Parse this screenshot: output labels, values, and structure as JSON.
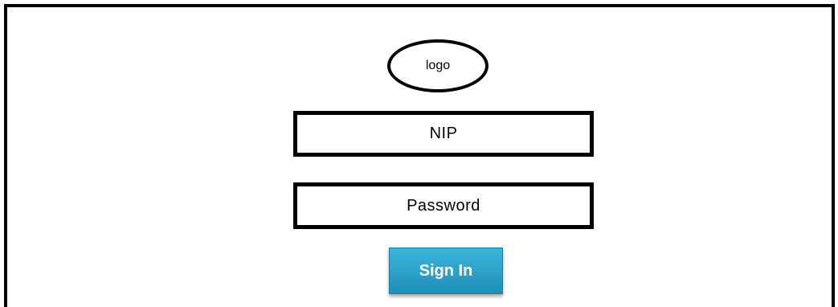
{
  "logo": {
    "label": "logo"
  },
  "form": {
    "nip_label": "NIP",
    "password_label": "Password",
    "sign_in_label": "Sign In"
  },
  "colors": {
    "button_top": "#3bb5dc",
    "button_bottom": "#1f8fb8",
    "border": "#000000"
  }
}
